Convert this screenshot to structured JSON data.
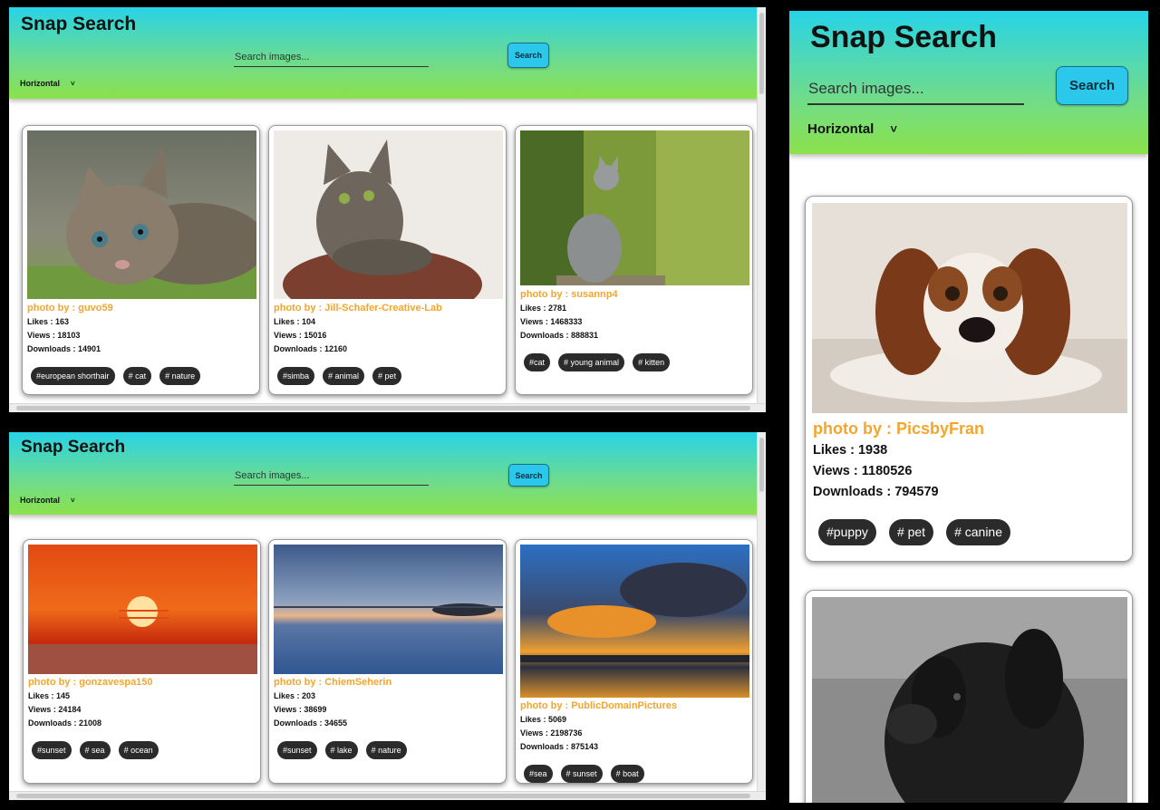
{
  "app": {
    "title": "Snap Search",
    "search_placeholder": "Search images...",
    "search_button": "Search",
    "orientation": "Horizontal"
  },
  "labels": {
    "photo_by": "photo by : ",
    "likes": "Likes : ",
    "views": "Views : ",
    "downloads": "Downloads : "
  },
  "panels": {
    "top": {
      "cards": [
        {
          "user": "guvo59",
          "likes": "163",
          "views": "18103",
          "downloads": "14901",
          "tags": [
            "#european shorthair",
            "# cat",
            "# nature"
          ]
        },
        {
          "user": "Jill-Schafer-Creative-Lab",
          "likes": "104",
          "views": "15016",
          "downloads": "12160",
          "tags": [
            "#simba",
            "# animal",
            "# pet"
          ]
        },
        {
          "user": "susannp4",
          "likes": "2781",
          "views": "1468333",
          "downloads": "888831",
          "tags": [
            "#cat",
            "# young animal",
            "# kitten"
          ]
        }
      ]
    },
    "bottom": {
      "cards": [
        {
          "user": "gonzavespa150",
          "likes": "145",
          "views": "24184",
          "downloads": "21008",
          "tags": [
            "#sunset",
            "# sea",
            "# ocean"
          ]
        },
        {
          "user": "ChiemSeherin",
          "likes": "203",
          "views": "38699",
          "downloads": "34655",
          "tags": [
            "#sunset",
            "# lake",
            "# nature"
          ]
        },
        {
          "user": "PublicDomainPictures",
          "likes": "5069",
          "views": "2198736",
          "downloads": "875143",
          "tags": [
            "#sea",
            "# sunset",
            "# boat"
          ]
        }
      ]
    },
    "right": {
      "cards": [
        {
          "user": "PicsbyFran",
          "likes": "1938",
          "views": "1180526",
          "downloads": "794579",
          "tags": [
            "#puppy",
            "# pet",
            "# canine"
          ]
        }
      ]
    }
  },
  "colors": {
    "header_top": "#27d3e8",
    "header_bottom": "#8ce24a",
    "accent_button": "#2bc8ec",
    "credit_text": "#f4a52c",
    "tag_bg": "#2b2b2b"
  }
}
